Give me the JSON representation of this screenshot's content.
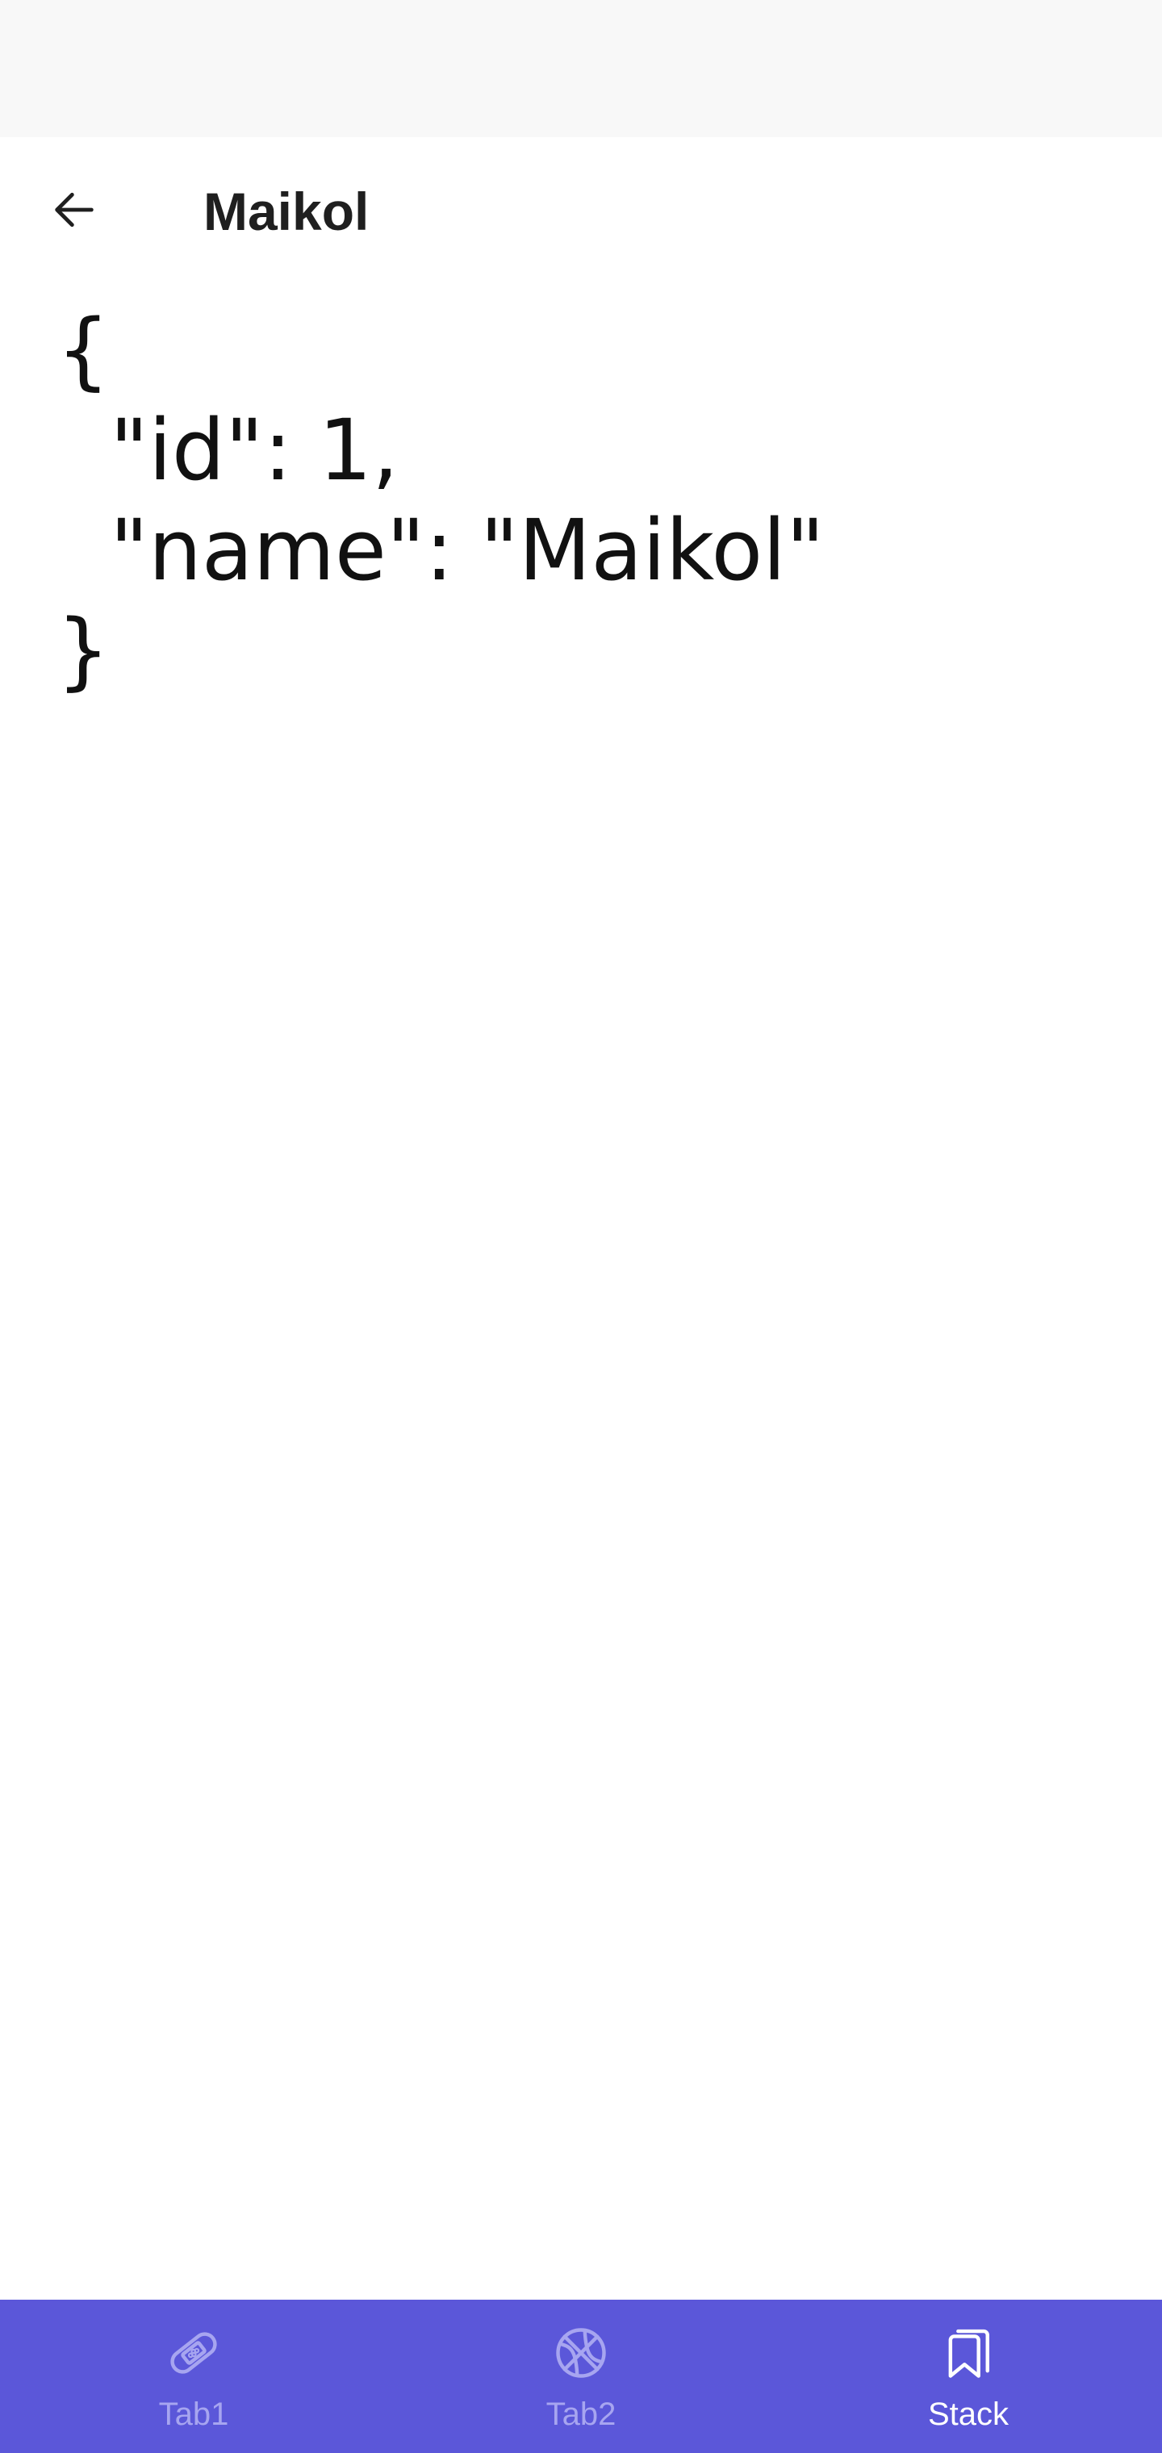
{
  "header": {
    "title": "Maikol",
    "back_icon": "arrow-left-icon"
  },
  "content": {
    "json_text": "{\n  \"id\": 1,\n  \"name\": \"Maikol\"\n}"
  },
  "tabs": [
    {
      "label": "Tab1",
      "icon": "bandage-icon",
      "active": false
    },
    {
      "label": "Tab2",
      "icon": "basketball-icon",
      "active": false
    },
    {
      "label": "Stack",
      "icon": "bookmarks-icon",
      "active": true
    }
  ],
  "colors": {
    "tab_bar_bg": "#5b57d9",
    "tab_active": "#ffffff",
    "tab_inactive": "#a7a5f0",
    "status_bar_bg": "#f8f8f8"
  }
}
